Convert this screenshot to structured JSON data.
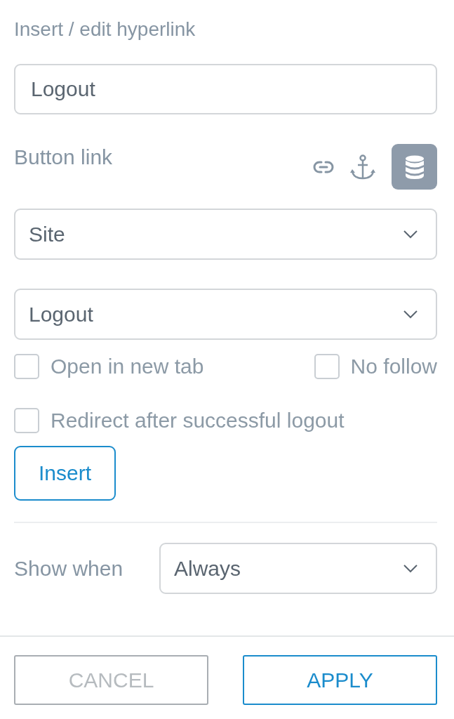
{
  "dialog": {
    "title": "Insert / edit hyperlink"
  },
  "link_text": {
    "value": "Logout"
  },
  "link_type": {
    "label": "Button link",
    "options": [
      {
        "kind": "url",
        "selected": false
      },
      {
        "kind": "anchor",
        "selected": false
      },
      {
        "kind": "database",
        "selected": true
      }
    ]
  },
  "selects": [
    {
      "value": "Site"
    },
    {
      "value": "Logout"
    }
  ],
  "checkbox_rows": [
    {
      "checkboxes": [
        {
          "label": "Open in new tab",
          "checked": false
        },
        {
          "label": "No follow",
          "checked": false
        }
      ]
    },
    {
      "checkboxes": [
        {
          "label": "Redirect after successful logout",
          "checked": false
        }
      ]
    }
  ],
  "insert_button": {
    "label": "Insert"
  },
  "show_when": {
    "label": "Show when",
    "value": "Always"
  },
  "footer": {
    "buttons": [
      {
        "label": "CANCEL",
        "kind": "secondary"
      },
      {
        "label": "APPLY",
        "kind": "primary"
      }
    ]
  }
}
